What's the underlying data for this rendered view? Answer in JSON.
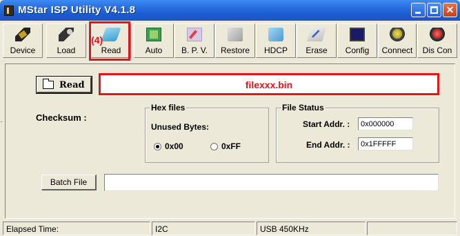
{
  "window": {
    "title": "MStar ISP Utility V4.1.8",
    "title_color": "#1a56c8"
  },
  "toolbar": {
    "buttons": [
      {
        "label": "Device",
        "icon": "chip-icon"
      },
      {
        "label": "Load",
        "icon": "load-chip-icon"
      },
      {
        "label": "Read",
        "icon": "read-icon"
      },
      {
        "label": "Auto",
        "icon": "auto-icon"
      },
      {
        "label": "B. P. V.",
        "icon": "bpv-icon"
      },
      {
        "label": "Restore",
        "icon": "restore-icon"
      },
      {
        "label": "HDCP",
        "icon": "hdcp-icon"
      },
      {
        "label": "Erase",
        "icon": "erase-icon"
      },
      {
        "label": "Config",
        "icon": "config-monitor-icon"
      },
      {
        "label": "Connect",
        "icon": "connect-icon"
      },
      {
        "label": "Dis Con",
        "icon": "disconnect-icon"
      }
    ],
    "step_annotation": "(4)",
    "annotation_color": "#e3141d"
  },
  "main": {
    "read_button_label": "Read",
    "file_name": "filexxx.bin",
    "checksum_label": "Checksum :",
    "hex_files": {
      "title": "Hex files",
      "unused_bytes_label": "Unused Bytes:",
      "options": [
        "0x00",
        "0xFF"
      ],
      "selected": "0x00"
    },
    "file_status": {
      "title": "File Status",
      "start_addr_label": "Start Addr. :",
      "start_addr_value": "0x000000",
      "end_addr_label": "End Addr. :",
      "end_addr_value": "0x1FFFFF"
    },
    "batch_file_label": "Batch File",
    "batch_file_value": ""
  },
  "statusbar": {
    "elapsed": "Elapsed Time:",
    "interface": "I2C",
    "usb": "USB  450KHz",
    "extra": ""
  }
}
